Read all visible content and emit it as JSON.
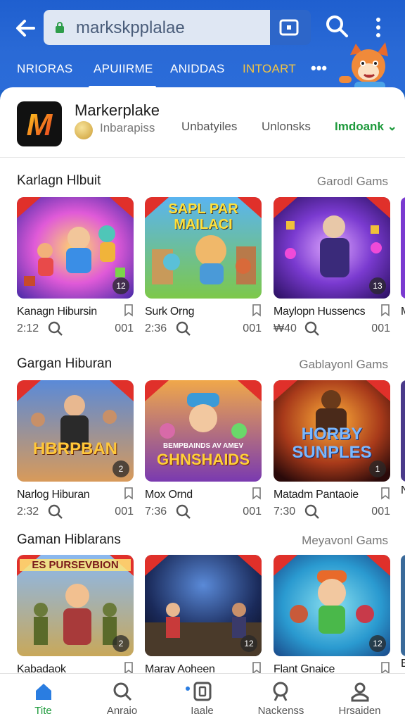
{
  "browser": {
    "url": "markskpplalae",
    "colors": {
      "bar": "#1f5fcf",
      "url_field": "#dfe7f3",
      "accent_yellow": "#f4c542"
    }
  },
  "nav": {
    "tabs": [
      {
        "label": "NRIORAS"
      },
      {
        "label": "APUIIRME"
      },
      {
        "label": "ANIDDAS"
      },
      {
        "label": "INTOART"
      }
    ],
    "more": "•••",
    "active_index": 1
  },
  "app": {
    "logo_text": "M",
    "title": "Markerplake",
    "developer": "Inbarapiss",
    "links": [
      "Unbatyiles",
      "Unlonsks",
      "Imdoank"
    ]
  },
  "sections": [
    {
      "title": "Karlagn Hlbuit",
      "more": "Garodl Gams",
      "cards": [
        {
          "title": "Kanagn Hibursin",
          "time": "2:12",
          "count": "001",
          "badge": "12"
        },
        {
          "title": "Surk Orng",
          "time": "2:36",
          "count": "001",
          "banner": "SAPL PAR MAILACI"
        },
        {
          "title": "Maylopn Hussencs",
          "time": "₩40",
          "count": "001",
          "badge": "13"
        },
        {
          "title": "M"
        }
      ]
    },
    {
      "title": "Gargan Hiburan",
      "more": "Gablayonl Gams",
      "cards": [
        {
          "title": "Narlog Hiburan",
          "time": "2:32",
          "count": "001",
          "badge": "2",
          "banner": "HBRPBAN"
        },
        {
          "title": "Mox Ornd",
          "time": "7:36",
          "count": "001",
          "banner": "GHNSHAIDS",
          "subbanner": "BEMPBAINDS AV AMEV"
        },
        {
          "title": "Matadm Pantaoie",
          "time": "7:30",
          "count": "001",
          "badge": "1",
          "banner": "HORBY SUNPLES"
        },
        {
          "title": "N"
        }
      ]
    },
    {
      "title": "Gaman Hiblarans",
      "more": "Meyavonl Gams",
      "cards": [
        {
          "title": "Kabadaok",
          "badge": "2",
          "banner": "ES PURSEVBION"
        },
        {
          "title": "Maray Aoheen",
          "badge": "12"
        },
        {
          "title": "Flant Gnaice",
          "badge": "12"
        },
        {
          "title": "E"
        }
      ]
    }
  ],
  "bottom_nav": [
    {
      "label": "Tite",
      "icon": "home-icon"
    },
    {
      "label": "Anraio",
      "icon": "search-icon"
    },
    {
      "label": "Iaale",
      "icon": "library-icon"
    },
    {
      "label": "Nackenss",
      "icon": "person-search-icon"
    },
    {
      "label": "Hrsaiden",
      "icon": "profile-icon"
    }
  ]
}
